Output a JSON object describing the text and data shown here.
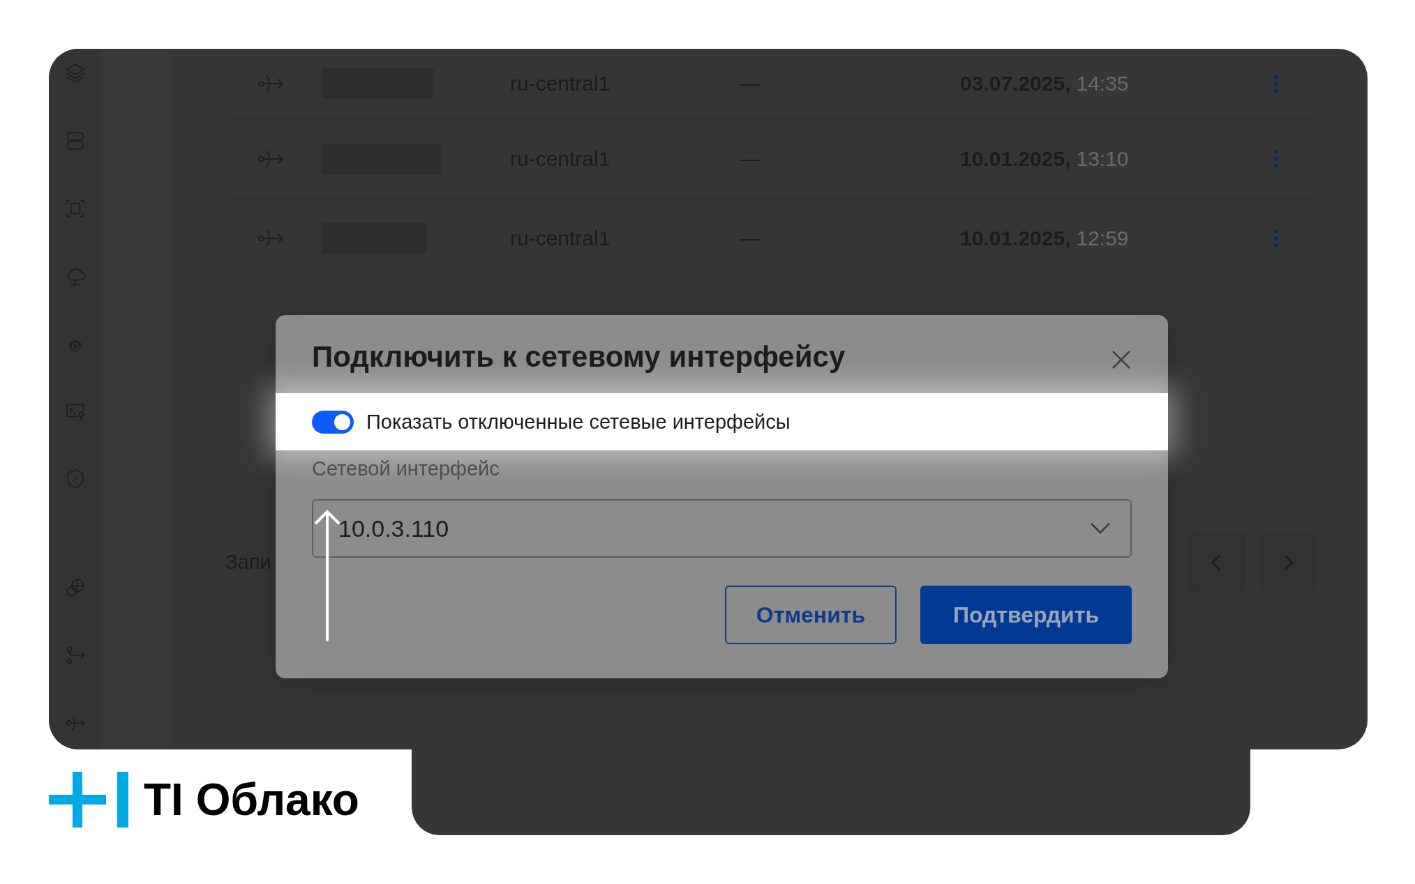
{
  "table": {
    "rows": [
      {
        "region": "ru-central1",
        "column_4": "—",
        "created_date": "03.07.2025,",
        "created_time": "14:35"
      },
      {
        "region": "ru-central1",
        "column_4": "—",
        "created_date": "10.01.2025,",
        "created_time": "13:10"
      },
      {
        "region": "ru-central1",
        "column_4": "—",
        "created_date": "10.01.2025,",
        "created_time": "12:59"
      }
    ]
  },
  "footer": {
    "records_label": "Запи"
  },
  "modal": {
    "title": "Подключить к сетевому интерфейсу",
    "toggle": {
      "label": "Показать отключенные сетевые интерфейсы",
      "on": true
    },
    "field": {
      "label": "Сетевой интерфейс",
      "value": "10.0.3.110"
    },
    "buttons": [
      {
        "label": "Отменить",
        "kind": "secondary"
      },
      {
        "label": "Подтвердить",
        "kind": "primary"
      }
    ]
  },
  "logo": {
    "text": "TI Облако"
  }
}
